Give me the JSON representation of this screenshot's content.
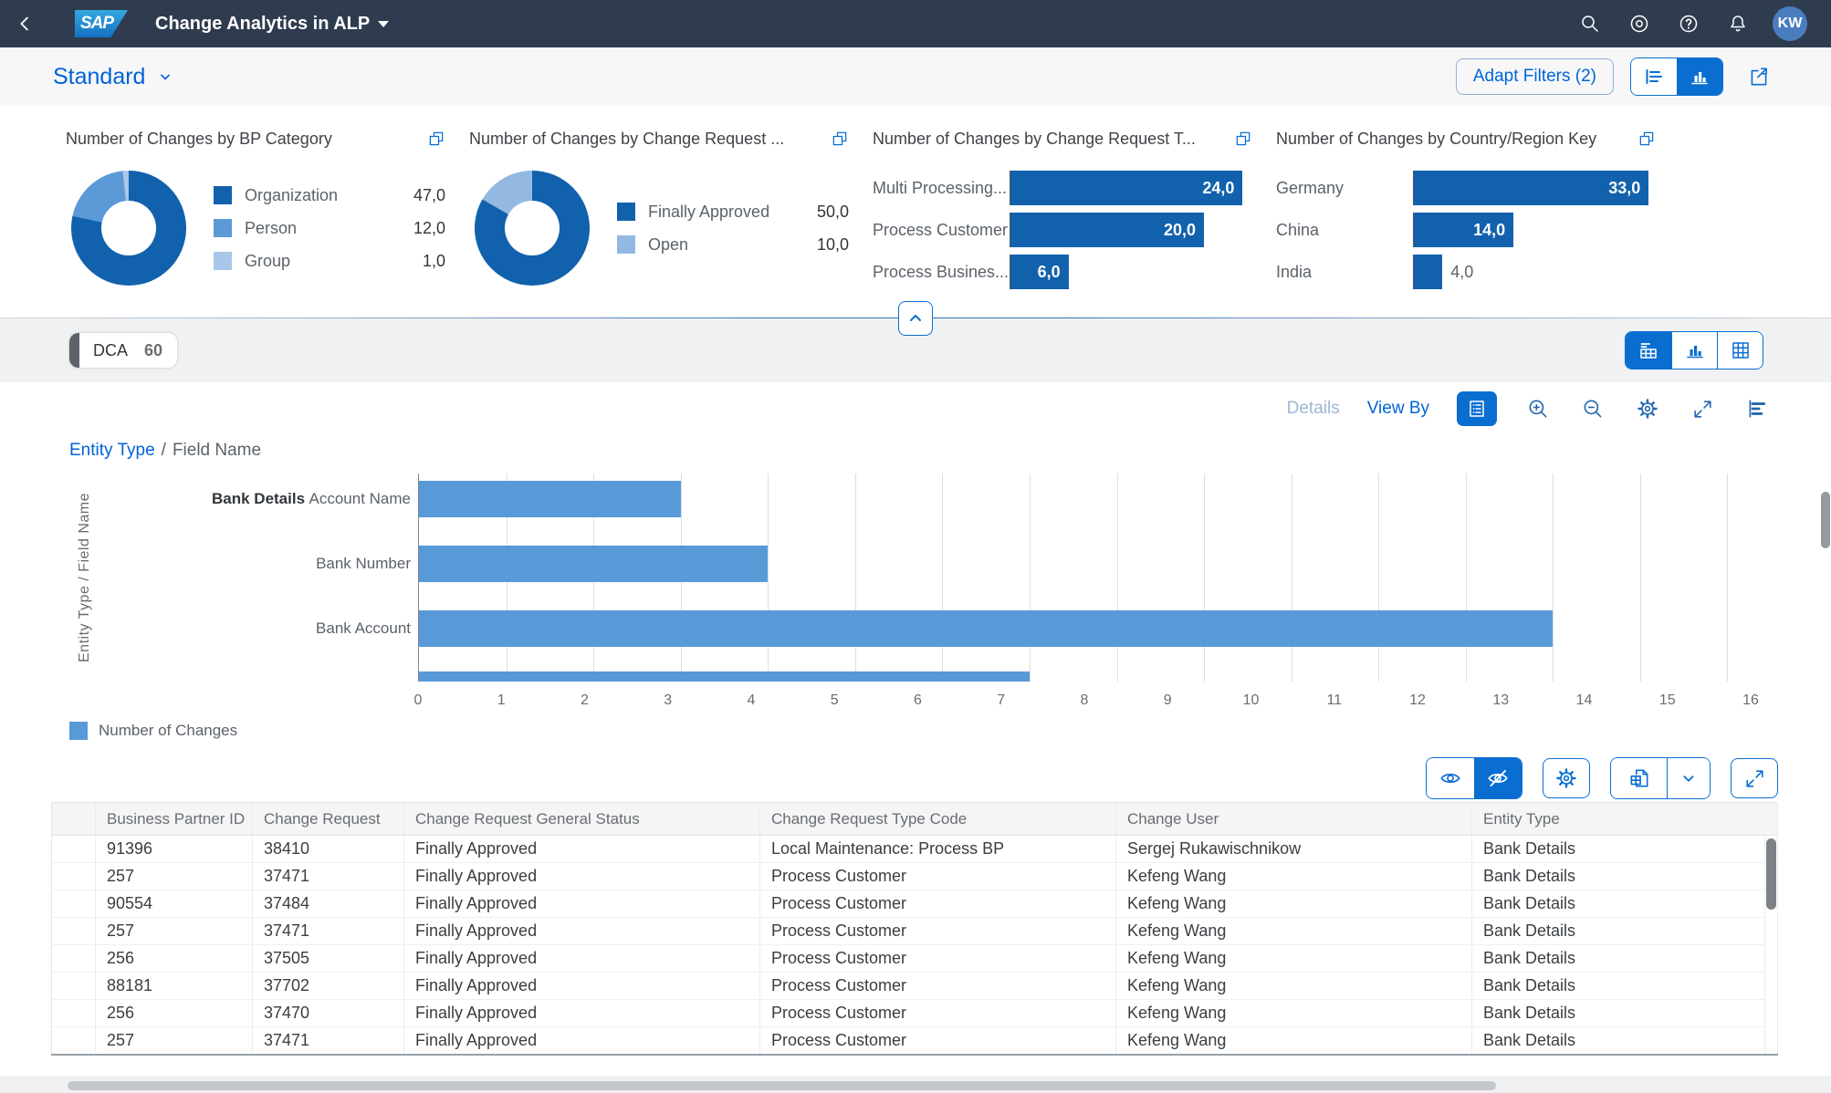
{
  "shell": {
    "title": "Change Analytics in ALP",
    "logo_text": "SAP",
    "avatar_initials": "KW"
  },
  "filter_bar": {
    "variant_label": "Standard",
    "adapt_filters_label": "Adapt Filters (2)"
  },
  "subheader": {
    "chip_label": "DCA",
    "chip_count": "60"
  },
  "chart_toolbar": {
    "details_label": "Details",
    "view_by_label": "View By"
  },
  "breadcrumb": {
    "link": "Entity Type",
    "separator": "/",
    "current": "Field Name"
  },
  "chart_data": [
    {
      "id": "bp_category",
      "type": "pie",
      "subtype": "donut",
      "title": "Number of Changes by BP Category",
      "categories": [
        "Organization",
        "Person",
        "Group"
      ],
      "values": [
        47,
        12,
        1
      ],
      "value_labels": [
        "47,0",
        "12,0",
        "1,0"
      ],
      "colors": [
        "#1161ad",
        "#5b99d7",
        "#a9c7e8"
      ],
      "legend_position": "right"
    },
    {
      "id": "cr_status",
      "type": "pie",
      "subtype": "donut",
      "title": "Number of Changes by Change Request ...",
      "categories": [
        "Finally Approved",
        "Open"
      ],
      "values": [
        50,
        10
      ],
      "value_labels": [
        "50,0",
        "10,0"
      ],
      "colors": [
        "#1161ad",
        "#93b9e2"
      ],
      "legend_position": "right"
    },
    {
      "id": "cr_type_code",
      "type": "bar",
      "orientation": "horizontal",
      "title": "Number of Changes by Change Request T...",
      "categories": [
        "Multi Processing...",
        "Process Customer",
        "Process Busines..."
      ],
      "values": [
        24,
        20,
        6
      ],
      "value_labels": [
        "24,0",
        "20,0",
        "6,0"
      ],
      "value_inside": [
        true,
        true,
        true
      ],
      "axis_max": 25,
      "color": "#1161ad"
    },
    {
      "id": "country_region",
      "type": "bar",
      "orientation": "horizontal",
      "title": "Number of Changes by Country/Region Key",
      "categories": [
        "Germany",
        "China",
        "India"
      ],
      "values": [
        33,
        14,
        4
      ],
      "value_labels": [
        "33,0",
        "14,0",
        "4,0"
      ],
      "value_inside": [
        true,
        true,
        false
      ],
      "axis_max": 34,
      "color": "#1161ad"
    },
    {
      "id": "main_chart",
      "type": "bar",
      "orientation": "horizontal",
      "title": "Entity Type / Field Name",
      "group_label": "Bank Details",
      "categories": [
        "Account Name",
        "Bank Number",
        "Bank Account"
      ],
      "values": [
        3,
        4,
        13
      ],
      "partial_next_value": 7,
      "xlim": [
        0,
        16
      ],
      "xtick_step": 1,
      "grid": "vertical",
      "series_name": "Number of Changes",
      "color": "#5899d8",
      "legend_position": "bottom-left"
    }
  ],
  "table": {
    "headers": [
      "Business Partner ID",
      "Change Request",
      "Change Request General Status",
      "Change Request Type Code",
      "Change User",
      "Entity Type"
    ],
    "rows": [
      [
        "91396",
        "38410",
        "Finally Approved",
        "Local Maintenance: Process BP",
        "Sergej Rukawischnikow",
        "Bank Details"
      ],
      [
        "257",
        "37471",
        "Finally Approved",
        "Process Customer",
        "Kefeng Wang",
        "Bank Details"
      ],
      [
        "90554",
        "37484",
        "Finally Approved",
        "Process Customer",
        "Kefeng Wang",
        "Bank Details"
      ],
      [
        "257",
        "37471",
        "Finally Approved",
        "Process Customer",
        "Kefeng Wang",
        "Bank Details"
      ],
      [
        "256",
        "37505",
        "Finally Approved",
        "Process Customer",
        "Kefeng Wang",
        "Bank Details"
      ],
      [
        "88181",
        "37702",
        "Finally Approved",
        "Process Customer",
        "Kefeng Wang",
        "Bank Details"
      ],
      [
        "256",
        "37470",
        "Finally Approved",
        "Process Customer",
        "Kefeng Wang",
        "Bank Details"
      ],
      [
        "257",
        "37471",
        "Finally Approved",
        "Process Customer",
        "Kefeng Wang",
        "Bank Details"
      ]
    ]
  },
  "icons": {
    "shell": [
      "back-icon",
      "search-icon",
      "copilot-icon",
      "help-icon",
      "notifications-icon"
    ],
    "filter_bar": [
      "filter-list-view-icon",
      "bar-chart-view-icon",
      "share-icon"
    ],
    "cards": [
      "copy-icon"
    ],
    "view_switcher": [
      "chart-table-view-icon",
      "chart-view-icon",
      "table-view-icon"
    ],
    "chart_toolbar": [
      "legend-toggle-icon",
      "zoom-in-icon",
      "zoom-out-icon",
      "settings-icon",
      "fullscreen-icon",
      "bar-chart-type-icon"
    ],
    "table_toolbar": [
      "show-details-icon",
      "hide-details-icon",
      "settings-icon",
      "export-excel-icon",
      "dropdown-icon",
      "fullscreen-icon"
    ],
    "collapse": [
      "collapse-up-icon"
    ]
  },
  "colors": {
    "shell_bg": "#2f3c4f",
    "accent": "#0a6ed1",
    "link": "#0064d9",
    "dark_bar": "#1161ad",
    "main_bar": "#5899d8"
  }
}
